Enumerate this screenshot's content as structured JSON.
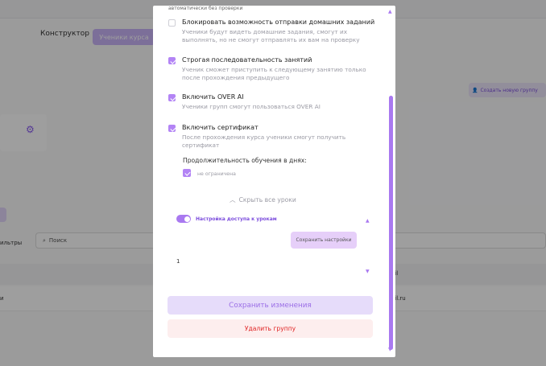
{
  "background": {
    "tabs": [
      "Конструктор",
      "Ученики курса"
    ],
    "create_group_label": "Создать новую группу",
    "filters_label": "ильтры",
    "search_placeholder": "Поиск",
    "table_header_right": "ail",
    "row_left": "и",
    "row_right": "ail.ru"
  },
  "modal": {
    "top_cut_text": "автоматически без проверки",
    "options": [
      {
        "title": "Блокировать возможность отправки домашних заданий",
        "description": "Ученики будут видеть домашние задания, смогут их выполнять, но не смогут отправлять их вам на проверку",
        "checked": false
      },
      {
        "title": "Строгая последовательность занятий",
        "description": "Ученик сможет приступить к следующему занятию только после прохождения предыдущего",
        "checked": true
      },
      {
        "title": "Включить OVER AI",
        "description": "Ученики групп смогут пользоваться OVER AI",
        "checked": true
      },
      {
        "title": "Включить сертификат",
        "description": "После прохождения курса ученики смогут получить сертификат",
        "checked": true
      }
    ],
    "duration_label": "Продолжительность обучения в днях:",
    "unlimited_label": "не ограничена",
    "unlimited_checked": true,
    "hide_lessons_label": "Скрыть все уроки",
    "access_toggle_label": "Настройка доступа к урокам",
    "access_toggle_on": true,
    "save_settings_label": "Сохранить настройки",
    "lesson_number": "1",
    "save_changes_label": "Сохранить изменения",
    "delete_group_label": "Удалить группу"
  },
  "colors": {
    "accent": "#a979f0",
    "danger": "#e02424",
    "overlay": "rgba(0,0,0,0.38)"
  }
}
